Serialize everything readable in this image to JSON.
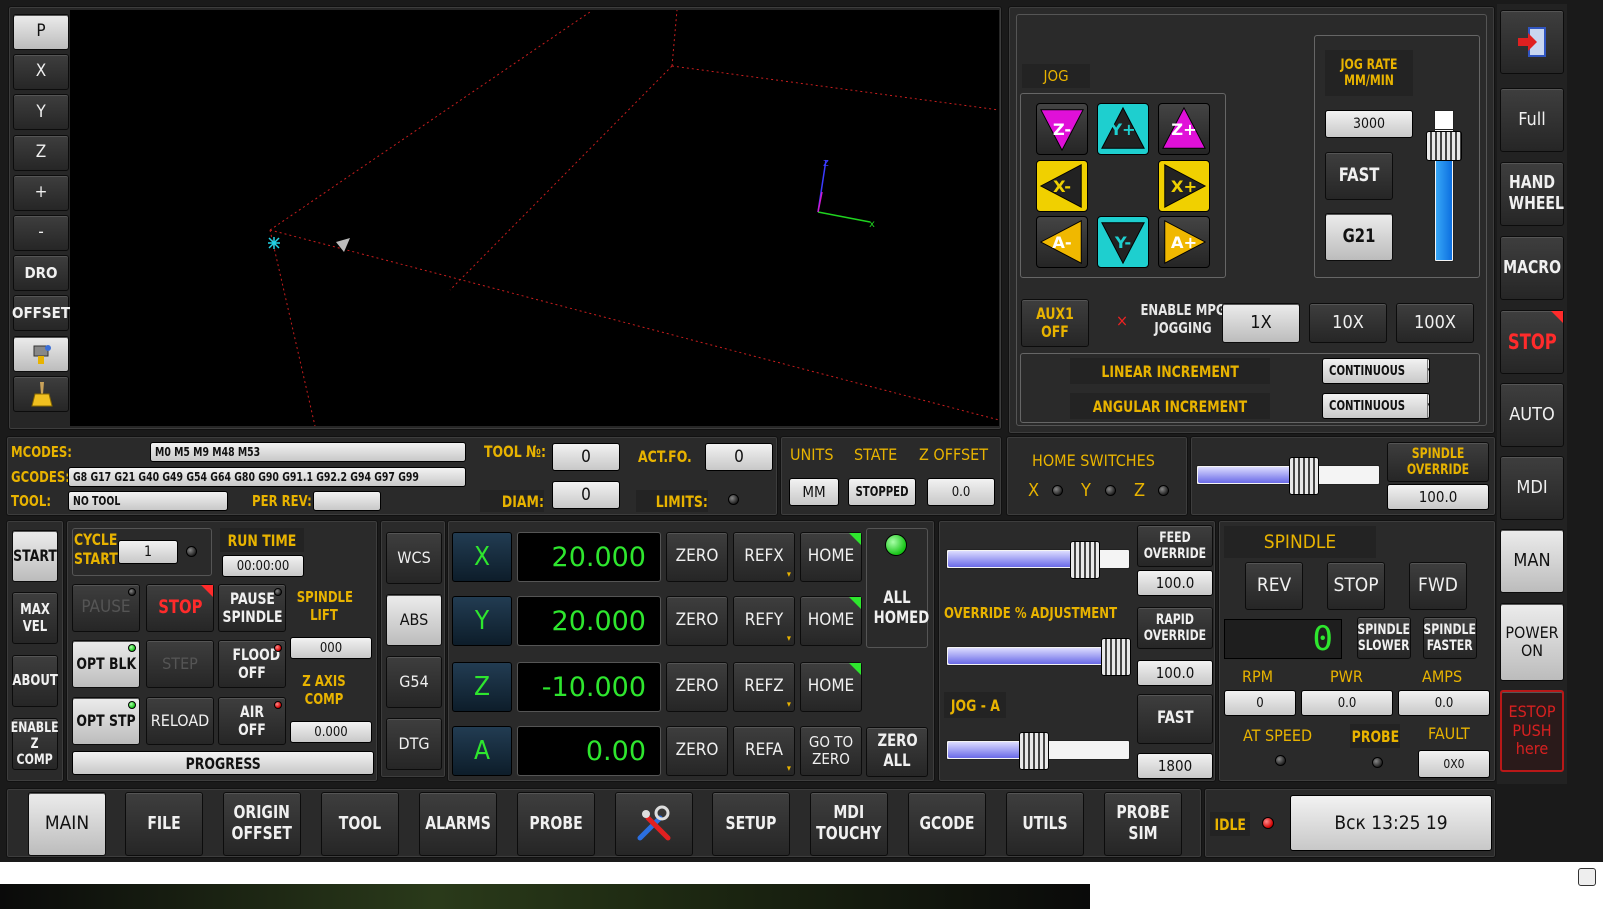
{
  "left_toolbar": [
    "P",
    "X",
    "Y",
    "Z",
    "+",
    "-",
    "DRO",
    "OFFSET"
  ],
  "jog": {
    "title": "JOG",
    "buttons": [
      {
        "label": "Z-",
        "color": "#e010d8",
        "dir": "down"
      },
      {
        "label": "Y+",
        "color": "#1ecfcf",
        "dir": "up"
      },
      {
        "label": "Z+",
        "color": "#e010d8",
        "dir": "up"
      },
      {
        "label": "X-",
        "color": "#f0d000",
        "dir": "left"
      },
      {
        "label": "X+",
        "color": "#f0d000",
        "dir": "right"
      },
      {
        "label": "A-",
        "color": "#f0b800",
        "dir": "left"
      },
      {
        "label": "Y-",
        "color": "#1ecfcf",
        "dir": "down"
      },
      {
        "label": "A+",
        "color": "#f0b800",
        "dir": "right"
      }
    ],
    "rate_title": "JOG RATE MM/MIN",
    "rate_value": "3000",
    "fast": "FAST",
    "units": "G21",
    "rate_slider_level": 0.75,
    "aux1": "AUX1 OFF",
    "mpg_label": "ENABLE MPG JOGGING",
    "mpg_mark": "×",
    "increments": [
      "1X",
      "10X",
      "100X"
    ],
    "linear_label": "LINEAR INCREMENT",
    "angular_label": "ANGULAR INCREMENT",
    "linear_value": "CONTINUOUS",
    "angular_value": "CONTINUOUS",
    "dropdown_arrow": "▾"
  },
  "right_bar": {
    "exit_icon": "exit-icon",
    "full": "Full",
    "handwheel": "HAND WHEEL",
    "macro": "MACRO",
    "stop": "STOP",
    "auto": "AUTO",
    "mdi": "MDI",
    "man": "MAN",
    "power": "POWER ON",
    "estop": "ESTOP PUSH here"
  },
  "info": {
    "mcodes_label": "MCODES:",
    "mcodes": "M0 M5 M9 M48 M53",
    "gcodes_label": "GCODES:",
    "gcodes": "G8 G17 G21 G40 G49 G54 G64 G80 G90 G91.1 G92.2 G94 G97 G99",
    "tool_label": "TOOL:",
    "tool": "NO TOOL",
    "per_rev": "PER REV:",
    "tool_no_label": "TOOL №:",
    "tool_no": "0",
    "actfo_label": "ACT.FO.",
    "actfo": "0",
    "diam_label": "DIAM:",
    "diam": "0",
    "limits_label": "LIMITS:"
  },
  "status": {
    "units_label": "UNITS",
    "state_label": "STATE",
    "zoffset_label": "Z OFFSET",
    "units": "MM",
    "state": "STOPPED",
    "zoffset": "0.0"
  },
  "home_switches": {
    "title": "HOME SWITCHES",
    "axes": [
      "X",
      "Y",
      "Z"
    ]
  },
  "spindle_override": {
    "label": "SPINDLE OVERRIDE",
    "value": "100.0",
    "level": 0.6
  },
  "left_actions": [
    "START",
    "MAX VEL",
    "ABOUT",
    "ENABLE Z COMP"
  ],
  "cycle": {
    "cycle_start": "CYCLE START",
    "cycle_value": "1",
    "run_time_label": "RUN TIME",
    "run_time": "00:00:00",
    "pause": "PAUSE",
    "stop": "STOP",
    "pause_spindle": "PAUSE SPINDLE",
    "spindle_lift": "SPINDLE LIFT",
    "spindle_lift_value": "000",
    "opt_blk": "OPT BLK",
    "step": "STEP",
    "flood": "FLOOD OFF",
    "z_axis_comp": "Z AXIS COMP",
    "z_comp_value": "0.000",
    "opt_stp": "OPT STP",
    "reload": "RELOAD",
    "air": "AIR OFF",
    "progress": "PROGRESS"
  },
  "coord_modes": [
    "WCS",
    "ABS",
    "G54",
    "DTG"
  ],
  "axes": [
    {
      "name": "X",
      "value": "20.000",
      "zero": "ZERO",
      "ref": "REFX",
      "home": "HOME"
    },
    {
      "name": "Y",
      "value": "20.000",
      "zero": "ZERO",
      "ref": "REFY",
      "home": "HOME"
    },
    {
      "name": "Z",
      "value": "-10.000",
      "zero": "ZERO",
      "ref": "REFZ",
      "home": "HOME"
    },
    {
      "name": "A",
      "value": "0.00",
      "zero": "ZERO",
      "ref": "REFA",
      "home": "GO TO ZERO"
    }
  ],
  "all_homed": "ALL HOMED",
  "zero_all": "ZERO ALL",
  "overrides": {
    "feed_label": "FEED OVERRIDE",
    "feed_value": "100.0",
    "feed_level": 0.8,
    "adjust_label": "OVERRIDE % ADJUSTMENT",
    "rapid_label": "RAPID OVERRIDE",
    "rapid_value": "100.0",
    "rapid_level": 1.0,
    "jog_a_label": "JOG - A",
    "fast": "FAST",
    "fast_value": "1800",
    "jog_a_level": 0.47
  },
  "spindle": {
    "title": "SPINDLE",
    "rev": "REV",
    "stop": "STOP",
    "fwd": "FWD",
    "speed_display": "0",
    "slower": "SPINDLE SLOWER",
    "faster": "SPINDLE FASTER",
    "rpm_label": "RPM",
    "pwr_label": "PWR",
    "amps_label": "AMPS",
    "rpm": "0",
    "pwr": "0.0",
    "amps": "0.0",
    "at_speed": "AT SPEED",
    "probe": "PROBE",
    "fault": "FAULT",
    "fault_value": "0X0"
  },
  "tabs": [
    "MAIN",
    "FILE",
    "ORIGIN OFFSET",
    "TOOL",
    "ALARMS",
    "PROBE",
    "",
    "SETUP",
    "MDI TOUCHY",
    "GCODE",
    "UTILS",
    "PROBE SIM"
  ],
  "machine_state": "IDLE",
  "clock": "Вск 13:25 19",
  "preview_axes": {
    "z": "z",
    "x": "x"
  },
  "colors": {
    "accent": "#e8b300",
    "dro_green": "#2ee62e",
    "stop_red": "#ff2b2b"
  }
}
